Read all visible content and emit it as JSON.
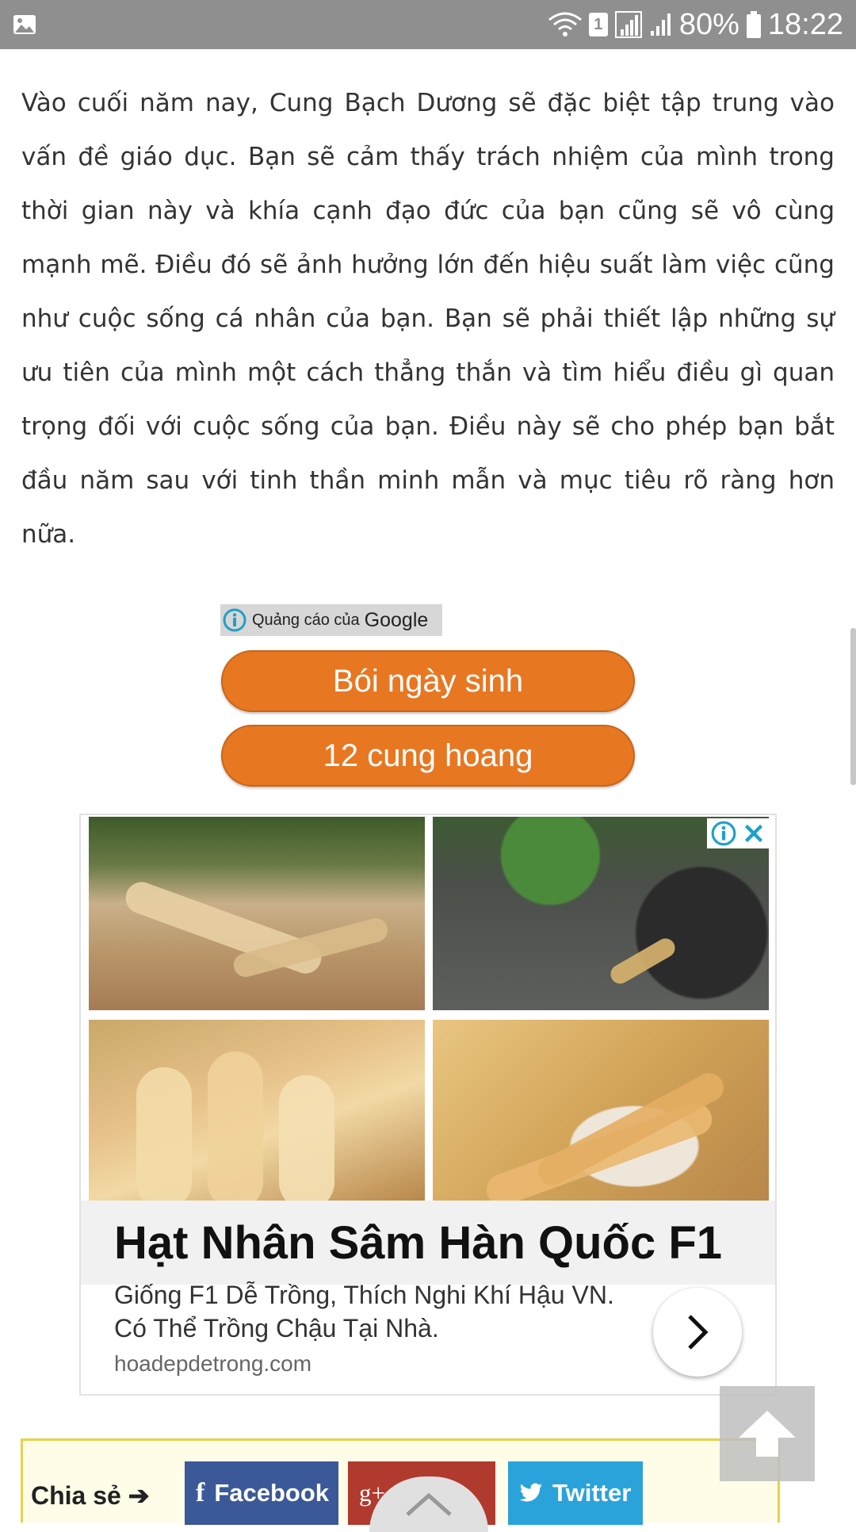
{
  "status_bar": {
    "sim_slot": "1",
    "battery": "80%",
    "time": "18:22"
  },
  "article": {
    "paragraph": "Vào cuối năm nay, Cung Bạch Dương sẽ đặc biệt tập trung vào vấn đề giáo dục. Bạn sẽ cảm thấy trách nhiệm của mình trong thời gian này và khía cạnh đạo đức của bạn cũng sẽ vô cùng mạnh mẽ. Điều đó sẽ ảnh hưởng lớn đến hiệu suất làm việc cũng như cuộc sống cá nhân của bạn. Bạn sẽ phải thiết lập những sự ưu tiên của mình một cách thẳng thắn và tìm hiểu điều gì quan trọng đối với cuộc sống của bạn. Điều này sẽ cho phép bạn bắt đầu năm sau với tinh thần minh mẫn và mục tiêu rõ ràng hơn nữa."
  },
  "ad_links": {
    "label_prefix": "Quảng cáo của",
    "label_brand": "Google",
    "buttons": [
      "Bói ngày sinh",
      "12 cung hoang"
    ]
  },
  "display_ad": {
    "headline": "Hạt Nhân Sâm Hàn Quốc F1",
    "description": "Giống F1 Dễ Trồng, Thích Nghi Khí Hậu VN. Có Thể Trồng Chậu Tại Nhà.",
    "domain": "hoadepdetrong.com"
  },
  "share_bar": {
    "label": "Chia sẻ ➔",
    "facebook": "Facebook",
    "twitter": "Twitter",
    "google_plus": "g+"
  },
  "colors": {
    "accent_button": "#e87722",
    "facebook": "#3b5998",
    "google_plus": "#b03a2e",
    "twitter": "#2aa3db",
    "adchoices": "#1fa0c8"
  }
}
